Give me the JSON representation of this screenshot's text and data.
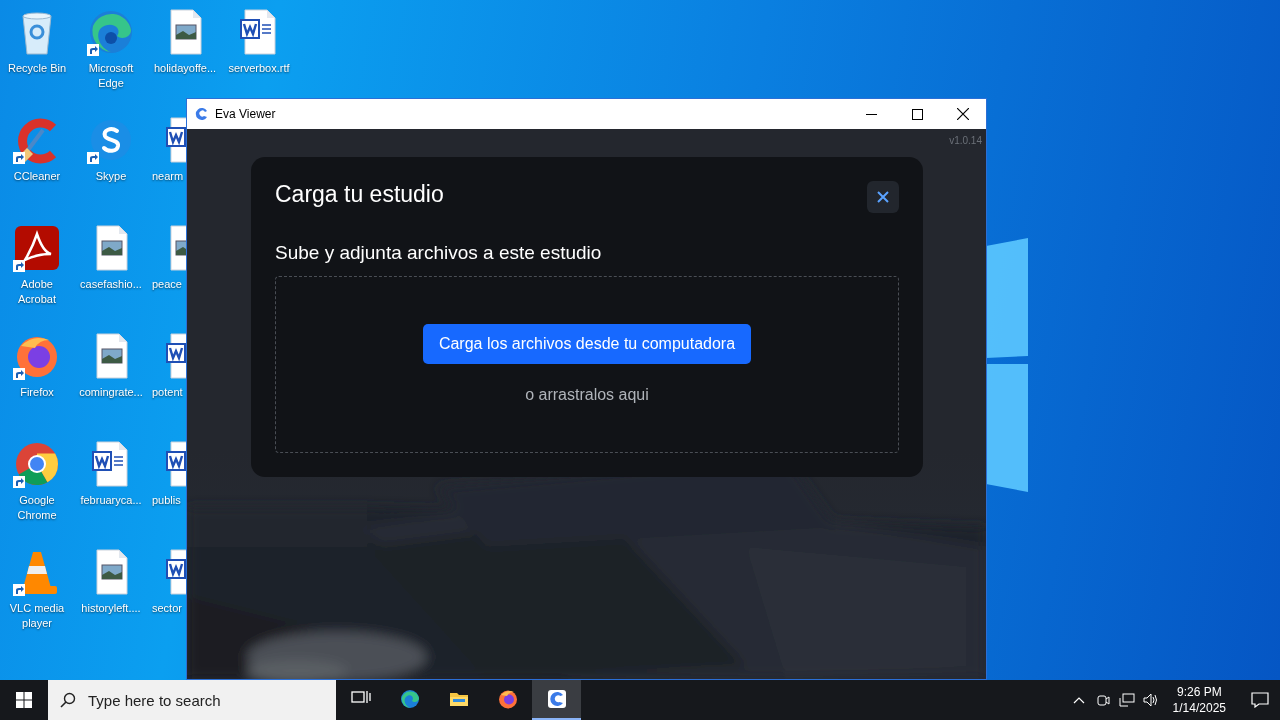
{
  "desktop_icons": {
    "columns": [
      [
        {
          "label": "Recycle Bin",
          "kind": "recycle",
          "shortcut": false
        },
        {
          "label": "CCleaner",
          "kind": "ccleaner",
          "shortcut": true
        },
        {
          "label": "Adobe Acrobat",
          "kind": "acrobat",
          "shortcut": true
        },
        {
          "label": "Firefox",
          "kind": "firefox",
          "shortcut": true
        },
        {
          "label": "Google Chrome",
          "kind": "chrome",
          "shortcut": true
        },
        {
          "label": "VLC media player",
          "kind": "vlc",
          "shortcut": true
        }
      ],
      [
        {
          "label": "Microsoft Edge",
          "kind": "edge",
          "shortcut": true
        },
        {
          "label": "Skype",
          "kind": "skype",
          "shortcut": true
        },
        {
          "label": "casefashio...",
          "kind": "image-file",
          "shortcut": false
        },
        {
          "label": "comingrate...",
          "kind": "image-file",
          "shortcut": false
        },
        {
          "label": "februaryca...",
          "kind": "word-file",
          "shortcut": false
        },
        {
          "label": "historyleft....",
          "kind": "image-file",
          "shortcut": false
        }
      ],
      [
        {
          "label": "holidayoffe...",
          "kind": "image-file",
          "shortcut": false
        },
        {
          "label": "nearm",
          "kind": "word-file",
          "shortcut": false
        },
        {
          "label": "peace",
          "kind": "image-file",
          "shortcut": false
        },
        {
          "label": "potent",
          "kind": "word-file",
          "shortcut": false
        },
        {
          "label": "publis",
          "kind": "word-file",
          "shortcut": false
        },
        {
          "label": "sector",
          "kind": "word-file",
          "shortcut": false
        }
      ],
      [
        {
          "label": "serverbox.rtf",
          "kind": "word-file",
          "shortcut": false
        }
      ]
    ]
  },
  "window": {
    "title": "Eva Viewer",
    "version": "v1.0.14"
  },
  "dialog": {
    "title": "Carga tu estudio",
    "subtitle": "Sube y adjunta archivos a este estudio",
    "upload_button": "Carga los archivos desde tu computadora",
    "drop_hint": "o arrastralos aqui"
  },
  "taskbar": {
    "search_placeholder": "Type here to search",
    "apps": [
      {
        "kind": "task-view",
        "selected": false
      },
      {
        "kind": "edge",
        "selected": false
      },
      {
        "kind": "folder",
        "selected": false
      },
      {
        "kind": "firefox",
        "selected": false
      },
      {
        "kind": "eva",
        "selected": true
      }
    ],
    "time": "9:26 PM",
    "date": "1/14/2025"
  }
}
